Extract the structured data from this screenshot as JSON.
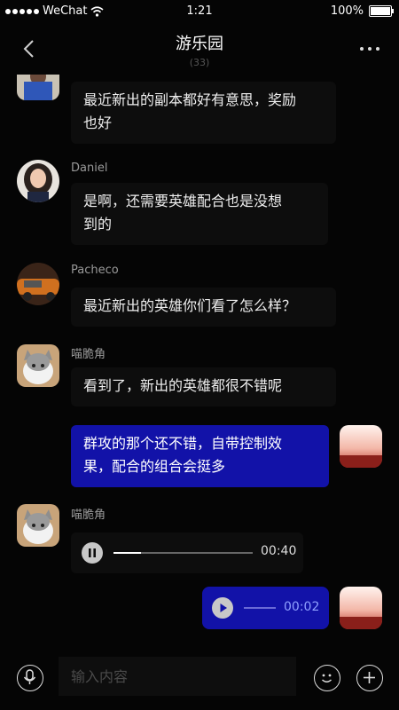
{
  "status_bar": {
    "carrier": "WeChat",
    "time": "1:21",
    "battery": "100%"
  },
  "header": {
    "title": "游乐园",
    "member_count": "(33)"
  },
  "messages": [
    {
      "text_lines": [
        "最近新出的副本都好有意思，奖励",
        "也好"
      ]
    },
    {
      "sender": "Daniel",
      "text_lines": [
        "是啊，还需要英雄配合也是没想",
        "到的"
      ]
    },
    {
      "sender": "Pacheco",
      "text": "最近新出的英雄你们看了怎么样？"
    },
    {
      "sender": "喵脆角",
      "text": "看到了，新出的英雄都很不错呢"
    },
    {
      "text_lines": [
        "群攻的那个还不错，自带控制效",
        "果，配合的组合会挺多"
      ],
      "mine": true
    },
    {
      "sender": "喵脆角",
      "voice_duration": "00:40",
      "progress": 0.2,
      "state": "paused"
    },
    {
      "voice_duration": "00:02",
      "mine": true,
      "state": "stopped"
    }
  ],
  "input": {
    "placeholder": "输入内容"
  },
  "colors": {
    "accent": "#1212a8",
    "bubble_other": "#0d0d0d",
    "background": "#050505"
  },
  "icons": [
    "back-icon",
    "more-icon",
    "microphone-icon",
    "emoji-icon",
    "plus-icon",
    "pause-icon",
    "play-icon"
  ]
}
